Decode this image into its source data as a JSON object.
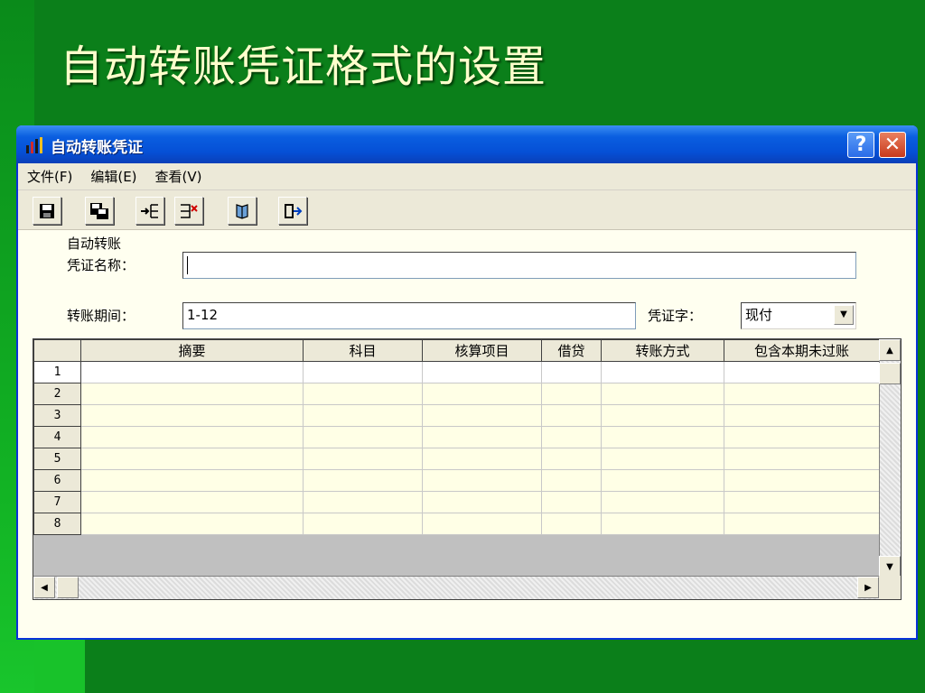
{
  "slide": {
    "title": "自动转账凭证格式的设置"
  },
  "window": {
    "title": "自动转账凭证",
    "help_label": "?",
    "close_label": "✕"
  },
  "menu": [
    {
      "label": "文件(F)"
    },
    {
      "label": "编辑(E)"
    },
    {
      "label": "查看(V)"
    }
  ],
  "toolbar": {
    "buttons": [
      "save-icon",
      "save-as-icon",
      "insert-row-icon",
      "delete-row-icon",
      "book-icon",
      "exit-icon"
    ]
  },
  "form": {
    "name_label_line1": "自动转账",
    "name_label_line2": "凭证名称：",
    "name_value": "",
    "period_label": "转账期间：",
    "period_value": "1-12",
    "voucher_type_label": "凭证字：",
    "voucher_type_value": "现付"
  },
  "grid": {
    "columns": [
      "摘要",
      "科目",
      "核算项目",
      "借贷",
      "转账方式",
      "包含本期未过账"
    ],
    "rows": [
      "1",
      "2",
      "3",
      "4",
      "5",
      "6",
      "7",
      "8"
    ]
  },
  "colors": {
    "slide_bg": "#0b7f1a",
    "title_text": "#ffffcc",
    "titlebar": "#0550d6",
    "grid_row": "#ffffe6"
  }
}
